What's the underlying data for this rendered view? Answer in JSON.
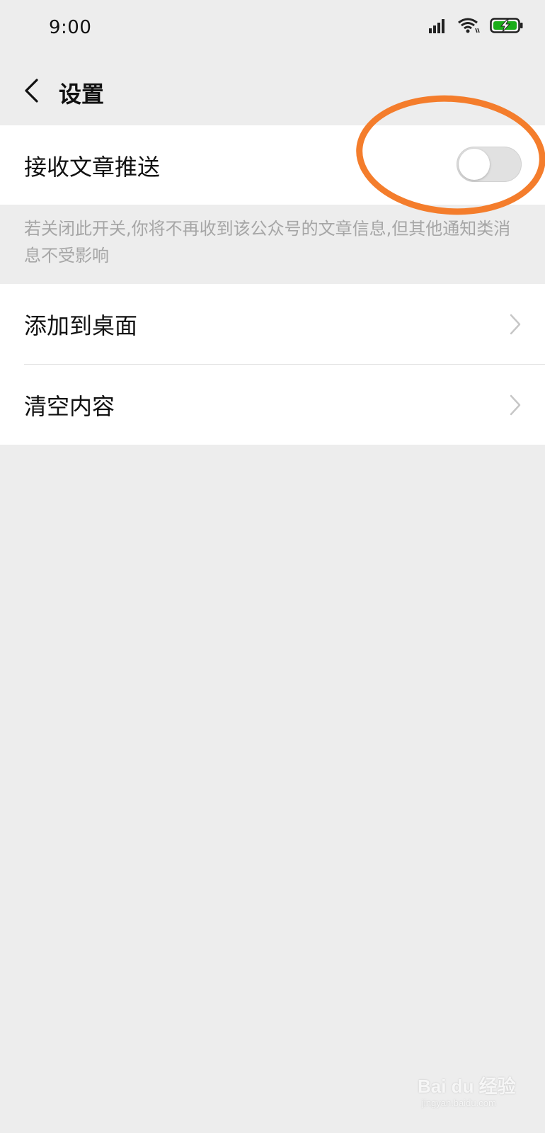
{
  "status_bar": {
    "time": "9:00",
    "icons": [
      "signal-icon",
      "wifi-icon",
      "battery-charging-icon"
    ]
  },
  "header": {
    "back_icon": "chevron-left-icon",
    "title": "设置"
  },
  "push_setting": {
    "label": "接收文章推送",
    "toggle_on": false,
    "hint": "若关闭此开关,你将不再收到该公众号的文章信息,但其他通知类消息不受影响"
  },
  "menu": {
    "items": [
      {
        "label": "添加到桌面",
        "icon": "chevron-right-icon"
      },
      {
        "label": "清空内容",
        "icon": "chevron-right-icon"
      }
    ]
  },
  "watermark": {
    "brand": "Bai du 经验",
    "url": "jingyan.baidu.com"
  },
  "colors": {
    "background": "#ededed",
    "cell": "#ffffff",
    "highlight": "#f47d2c",
    "battery": "#1aad19",
    "hint_text": "#a6a6a6"
  }
}
